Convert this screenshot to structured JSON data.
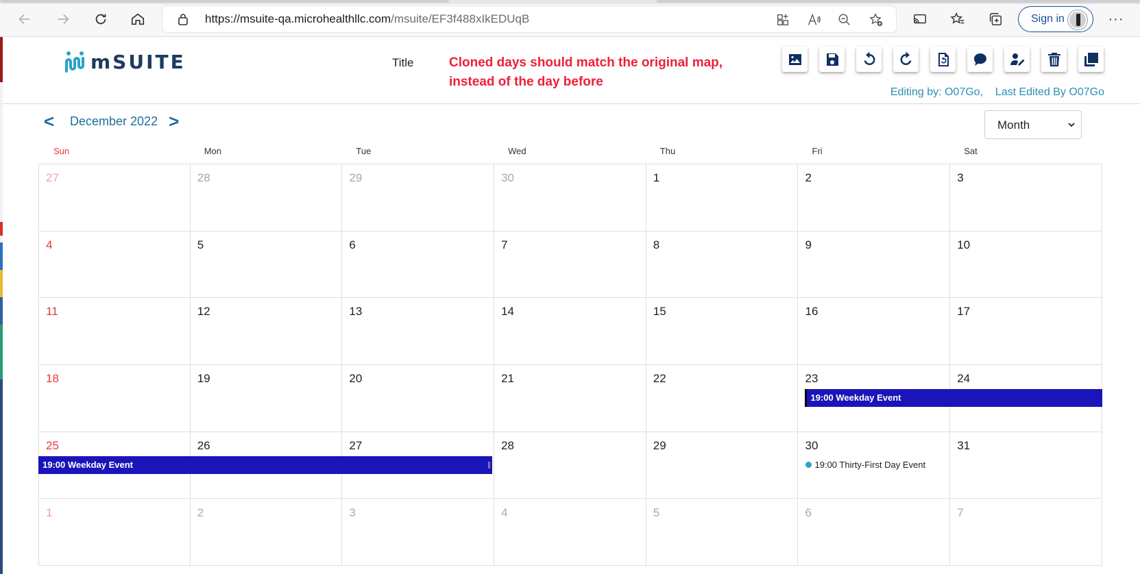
{
  "browser": {
    "url_main": "https://msuite-qa.microhealthllc.com",
    "url_path": "/msuite/EF3f488xIkEDUqB",
    "signin_label": "Sign in",
    "more_label": "···"
  },
  "app": {
    "logo_text": "mSUITE",
    "title_label": "Title",
    "title_value": "Cloned days should match the original map, instead of the day before",
    "editing_by": "Editing by: O07Go,",
    "last_edited": "Last Edited By O07Go",
    "toolbar": [
      "image-icon",
      "save-icon",
      "undo-icon",
      "redo-icon",
      "export-icon",
      "comment-icon",
      "user-edit-icon",
      "delete-icon",
      "clone-icon"
    ],
    "accent": "#2a8fb4",
    "brand": "#0f3063"
  },
  "calendar": {
    "month_label": "December 2022",
    "prev": "<",
    "next": ">",
    "view": "Month",
    "days_of_week": [
      "Sun",
      "Mon",
      "Tue",
      "Wed",
      "Thu",
      "Fri",
      "Sat"
    ],
    "weeks": [
      [
        "27",
        "28",
        "29",
        "30",
        "1",
        "2",
        "3"
      ],
      [
        "4",
        "5",
        "6",
        "7",
        "8",
        "9",
        "10"
      ],
      [
        "11",
        "12",
        "13",
        "14",
        "15",
        "16",
        "17"
      ],
      [
        "18",
        "19",
        "20",
        "21",
        "22",
        "23",
        "24"
      ],
      [
        "25",
        "26",
        "27",
        "28",
        "29",
        "30",
        "31"
      ],
      [
        "1",
        "2",
        "3",
        "4",
        "5",
        "6",
        "7"
      ]
    ],
    "events": {
      "weekday_1": "19:00 Weekday Event",
      "weekday_2": "19:00 Weekday Event",
      "thirty_first": "19:00 Thirty-First Day Event"
    },
    "event_color": "#1a15b8",
    "dot_color": "#2aa3c9"
  }
}
